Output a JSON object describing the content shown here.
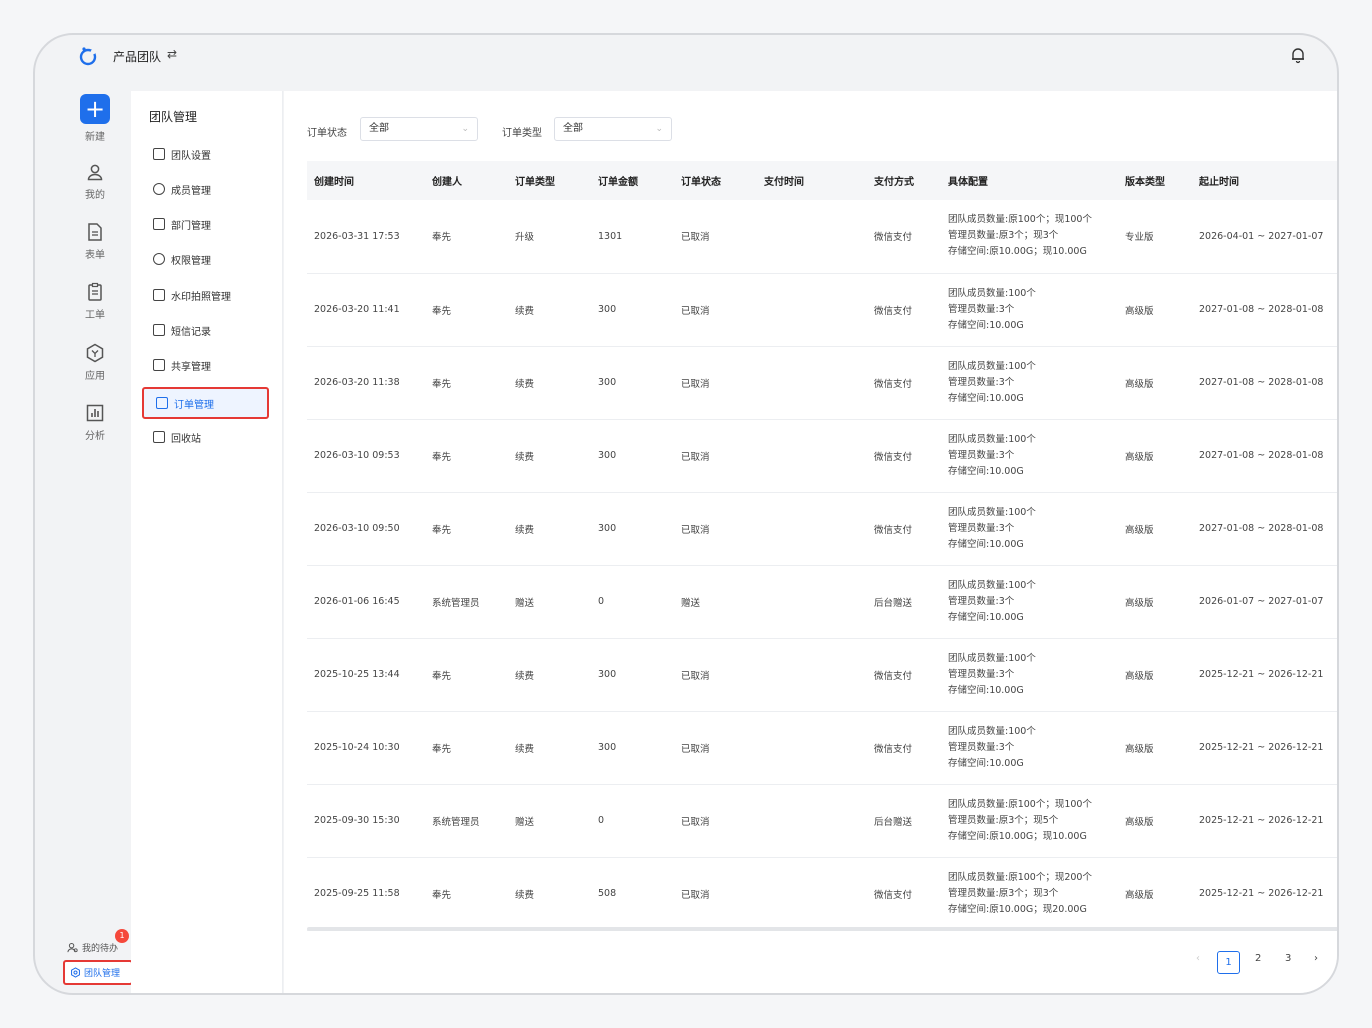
{
  "header": {
    "team_name": "产品团队",
    "swap_glyph": "⇄"
  },
  "rail": {
    "new_label": "新建",
    "items": [
      {
        "label": "我的",
        "icon": "user-icon"
      },
      {
        "label": "表单",
        "icon": "document-icon"
      },
      {
        "label": "工单",
        "icon": "clipboard-icon"
      },
      {
        "label": "应用",
        "icon": "app-icon"
      },
      {
        "label": "分析",
        "icon": "chart-icon"
      }
    ],
    "todo_label": "我的待办",
    "todo_badge": "1",
    "team_mgmt_label": "团队管理"
  },
  "sub_nav": {
    "title": "团队管理",
    "items": [
      {
        "label": "团队设置"
      },
      {
        "label": "成员管理"
      },
      {
        "label": "部门管理"
      },
      {
        "label": "权限管理"
      },
      {
        "label": "水印拍照管理"
      },
      {
        "label": "短信记录"
      },
      {
        "label": "共享管理"
      },
      {
        "label": "订单管理"
      },
      {
        "label": "回收站"
      }
    ]
  },
  "filters": {
    "status_label": "订单状态",
    "status_value": "全部",
    "type_label": "订单类型",
    "type_value": "全部"
  },
  "table": {
    "columns": [
      "创建时间",
      "创建人",
      "订单类型",
      "订单金额",
      "订单状态",
      "支付时间",
      "支付方式",
      "具体配置",
      "版本类型",
      "起止时间"
    ],
    "rows": [
      {
        "created": "2026-03-31 17:53",
        "creator": "奉先",
        "type": "升级",
        "amount": "1301",
        "status": "已取消",
        "paid_at": "",
        "pay_method": "微信支付",
        "cfg1": "团队成员数量:原100个；现100个",
        "cfg2": "管理员数量:原3个；现3个",
        "cfg3": "存储空间:原10.00G；现10.00G",
        "edition": "专业版",
        "period": "2026-04-01 ~ 2027-01-07"
      },
      {
        "created": "2026-03-20 11:41",
        "creator": "奉先",
        "type": "续费",
        "amount": "300",
        "status": "已取消",
        "paid_at": "",
        "pay_method": "微信支付",
        "cfg1": "团队成员数量:100个",
        "cfg2": "管理员数量:3个",
        "cfg3": "存储空间:10.00G",
        "edition": "高级版",
        "period": "2027-01-08 ~ 2028-01-08"
      },
      {
        "created": "2026-03-20 11:38",
        "creator": "奉先",
        "type": "续费",
        "amount": "300",
        "status": "已取消",
        "paid_at": "",
        "pay_method": "微信支付",
        "cfg1": "团队成员数量:100个",
        "cfg2": "管理员数量:3个",
        "cfg3": "存储空间:10.00G",
        "edition": "高级版",
        "period": "2027-01-08 ~ 2028-01-08"
      },
      {
        "created": "2026-03-10 09:53",
        "creator": "奉先",
        "type": "续费",
        "amount": "300",
        "status": "已取消",
        "paid_at": "",
        "pay_method": "微信支付",
        "cfg1": "团队成员数量:100个",
        "cfg2": "管理员数量:3个",
        "cfg3": "存储空间:10.00G",
        "edition": "高级版",
        "period": "2027-01-08 ~ 2028-01-08"
      },
      {
        "created": "2026-03-10 09:50",
        "creator": "奉先",
        "type": "续费",
        "amount": "300",
        "status": "已取消",
        "paid_at": "",
        "pay_method": "微信支付",
        "cfg1": "团队成员数量:100个",
        "cfg2": "管理员数量:3个",
        "cfg3": "存储空间:10.00G",
        "edition": "高级版",
        "period": "2027-01-08 ~ 2028-01-08"
      },
      {
        "created": "2026-01-06 16:45",
        "creator": "系统管理员",
        "type": "赠送",
        "amount": "0",
        "status": "赠送",
        "paid_at": "",
        "pay_method": "后台赠送",
        "cfg1": "团队成员数量:100个",
        "cfg2": "管理员数量:3个",
        "cfg3": "存储空间:10.00G",
        "edition": "高级版",
        "period": "2026-01-07 ~ 2027-01-07"
      },
      {
        "created": "2025-10-25 13:44",
        "creator": "奉先",
        "type": "续费",
        "amount": "300",
        "status": "已取消",
        "paid_at": "",
        "pay_method": "微信支付",
        "cfg1": "团队成员数量:100个",
        "cfg2": "管理员数量:3个",
        "cfg3": "存储空间:10.00G",
        "edition": "高级版",
        "period": "2025-12-21 ~ 2026-12-21"
      },
      {
        "created": "2025-10-24 10:30",
        "creator": "奉先",
        "type": "续费",
        "amount": "300",
        "status": "已取消",
        "paid_at": "",
        "pay_method": "微信支付",
        "cfg1": "团队成员数量:100个",
        "cfg2": "管理员数量:3个",
        "cfg3": "存储空间:10.00G",
        "edition": "高级版",
        "period": "2025-12-21 ~ 2026-12-21"
      },
      {
        "created": "2025-09-30 15:30",
        "creator": "系统管理员",
        "type": "赠送",
        "amount": "0",
        "status": "已取消",
        "paid_at": "",
        "pay_method": "后台赠送",
        "cfg1": "团队成员数量:原100个；现100个",
        "cfg2": "管理员数量:原3个；现5个",
        "cfg3": "存储空间:原10.00G；现10.00G",
        "edition": "高级版",
        "period": "2025-12-21 ~ 2026-12-21"
      },
      {
        "created": "2025-09-25 11:58",
        "creator": "奉先",
        "type": "续费",
        "amount": "508",
        "status": "已取消",
        "paid_at": "",
        "pay_method": "微信支付",
        "cfg1": "团队成员数量:原100个；现200个",
        "cfg2": "管理员数量:原3个；现3个",
        "cfg3": "存储空间:原10.00G；现20.00G",
        "edition": "高级版",
        "period": "2025-12-21 ~ 2026-12-21"
      }
    ]
  },
  "pagination": {
    "prev": "‹",
    "pages": [
      "1",
      "2",
      "3"
    ],
    "next": "›"
  },
  "colors": {
    "accent": "#1f6feb",
    "highlight_border": "#e53935",
    "gift_status": "#f5a623",
    "cancel_status": "#bbbbbb"
  }
}
